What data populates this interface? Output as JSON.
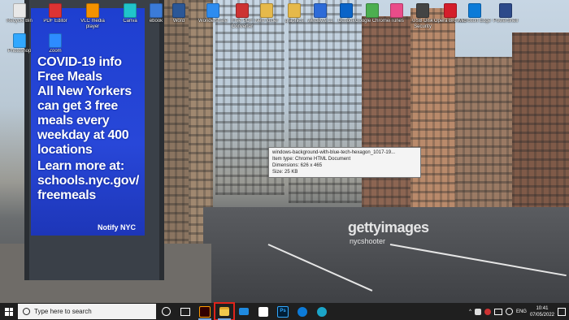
{
  "kiosk": {
    "lines": [
      "COVID-19 info",
      "Free Meals",
      "All New Yorkers",
      "can get 3 free",
      "meals every",
      "weekday at 400",
      "locations",
      "Learn more at:",
      "schools.nyc.gov/",
      "freemeals"
    ],
    "notify": "Notify NYC"
  },
  "watermark": {
    "brand": "gettyimages",
    "credit": "nycshooter"
  },
  "desktop_icons": [
    {
      "label": "Recycle Bin",
      "color": "#e8e8e8"
    },
    {
      "label": "PDF Editor",
      "color": "#d33"
    },
    {
      "label": "VLC media player",
      "color": "#f39200"
    },
    {
      "label": "Canva",
      "color": "#20c4cb"
    },
    {
      "label": "ebook",
      "color": "#3b7bd8"
    },
    {
      "label": "Word",
      "color": "#2b5797"
    },
    {
      "label": "Wondershare",
      "color": "#2d8cf0"
    },
    {
      "label": "Free PDF Converter",
      "color": "#c33"
    },
    {
      "label": "New folder",
      "color": "#e6b94a"
    },
    {
      "label": "graphics",
      "color": "#e6b94a"
    },
    {
      "label": "windows 11",
      "color": "#2d6bd8"
    },
    {
      "label": "Outlook",
      "color": "#0a64c8"
    },
    {
      "label": "Google Chrome",
      "color": "#4caf50"
    },
    {
      "label": "iTunes",
      "color": "#ea4c89"
    },
    {
      "label": "USB Disk Security",
      "color": "#444"
    },
    {
      "label": "Opera Browser",
      "color": "#d41e2b"
    },
    {
      "label": "Microsoft Edge",
      "color": "#0c7bd8"
    },
    {
      "label": "PowerShell",
      "color": "#2d4a8a"
    },
    {
      "label": "Photoshop",
      "color": "#31a8ff"
    },
    {
      "label": "Zoom",
      "color": "#2d8cff"
    }
  ],
  "tooltip": {
    "lines": [
      "windows-background-with-blue-tech-hexagon_1017-19...",
      "Item type: Chrome HTML Document",
      "Dimensions: 626 x 465",
      "Size: 25 KB"
    ]
  },
  "taskbar": {
    "search_placeholder": "Type here to search",
    "pinned": [
      {
        "name": "task-view",
        "color": "#ffffff"
      },
      {
        "name": "illustrator",
        "color": "#ff9a00"
      },
      {
        "name": "file-explorer",
        "color": "#f2c94c"
      },
      {
        "name": "mail",
        "color": "#1f8ae0"
      },
      {
        "name": "store",
        "color": "#ffffff"
      },
      {
        "name": "photoshop",
        "color": "#31a8ff"
      },
      {
        "name": "edge",
        "color": "#0c7bd8"
      },
      {
        "name": "edge-dev",
        "color": "#1ba5c9"
      }
    ],
    "language": "ENG",
    "time": "10:41",
    "date": "07/05/2022"
  },
  "colors": {
    "taskbar": "#1f1f1f",
    "highlight": "#e0241b"
  }
}
